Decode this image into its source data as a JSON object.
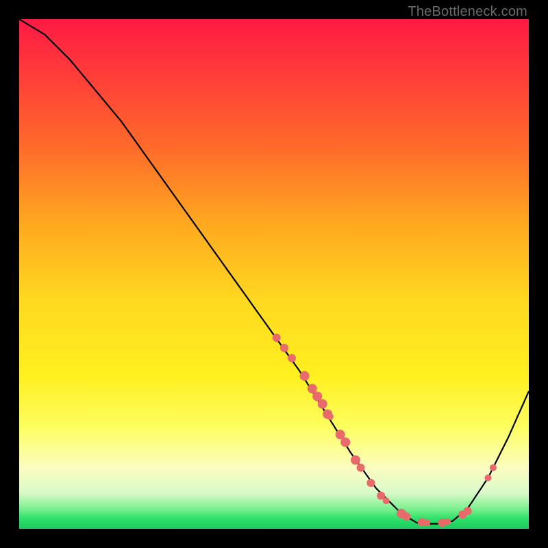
{
  "watermark": "TheBottleneck.com",
  "chart_data": {
    "type": "line",
    "title": "",
    "xlabel": "",
    "ylabel": "",
    "xlim": [
      0,
      100
    ],
    "ylim": [
      0,
      100
    ],
    "curve": [
      {
        "x": 0,
        "y": 100
      },
      {
        "x": 5,
        "y": 97
      },
      {
        "x": 10,
        "y": 92
      },
      {
        "x": 20,
        "y": 80
      },
      {
        "x": 30,
        "y": 66
      },
      {
        "x": 40,
        "y": 52
      },
      {
        "x": 50,
        "y": 38
      },
      {
        "x": 55,
        "y": 31
      },
      {
        "x": 60,
        "y": 23
      },
      {
        "x": 65,
        "y": 15
      },
      {
        "x": 70,
        "y": 8
      },
      {
        "x": 75,
        "y": 3
      },
      {
        "x": 78,
        "y": 1.2
      },
      {
        "x": 80,
        "y": 1
      },
      {
        "x": 82,
        "y": 1
      },
      {
        "x": 85,
        "y": 1.5
      },
      {
        "x": 88,
        "y": 4
      },
      {
        "x": 92,
        "y": 10
      },
      {
        "x": 96,
        "y": 18
      },
      {
        "x": 100,
        "y": 27
      }
    ],
    "dots": [
      {
        "x": 50.5,
        "y": 37.5,
        "r": 6
      },
      {
        "x": 52,
        "y": 35.5,
        "r": 6
      },
      {
        "x": 53.5,
        "y": 33.5,
        "r": 6
      },
      {
        "x": 56,
        "y": 30,
        "r": 7
      },
      {
        "x": 57.5,
        "y": 27.5,
        "r": 7
      },
      {
        "x": 58.5,
        "y": 26,
        "r": 7
      },
      {
        "x": 59.5,
        "y": 24.5,
        "r": 7
      },
      {
        "x": 60.5,
        "y": 22.5,
        "r": 7
      },
      {
        "x": 61,
        "y": 22,
        "r": 5
      },
      {
        "x": 63,
        "y": 18.5,
        "r": 7
      },
      {
        "x": 64,
        "y": 17,
        "r": 7
      },
      {
        "x": 66,
        "y": 13.5,
        "r": 7
      },
      {
        "x": 67,
        "y": 12,
        "r": 6
      },
      {
        "x": 69,
        "y": 9,
        "r": 6
      },
      {
        "x": 71,
        "y": 6.5,
        "r": 6
      },
      {
        "x": 72,
        "y": 5.5,
        "r": 5
      },
      {
        "x": 75,
        "y": 3,
        "r": 7
      },
      {
        "x": 76,
        "y": 2.4,
        "r": 6
      },
      {
        "x": 79,
        "y": 1.3,
        "r": 6
      },
      {
        "x": 80,
        "y": 1.2,
        "r": 5
      },
      {
        "x": 83,
        "y": 1.2,
        "r": 6
      },
      {
        "x": 84,
        "y": 1.4,
        "r": 5
      },
      {
        "x": 87,
        "y": 2.8,
        "r": 6
      },
      {
        "x": 88,
        "y": 3.5,
        "r": 6
      },
      {
        "x": 92,
        "y": 10,
        "r": 5
      },
      {
        "x": 93,
        "y": 12,
        "r": 5
      }
    ]
  }
}
